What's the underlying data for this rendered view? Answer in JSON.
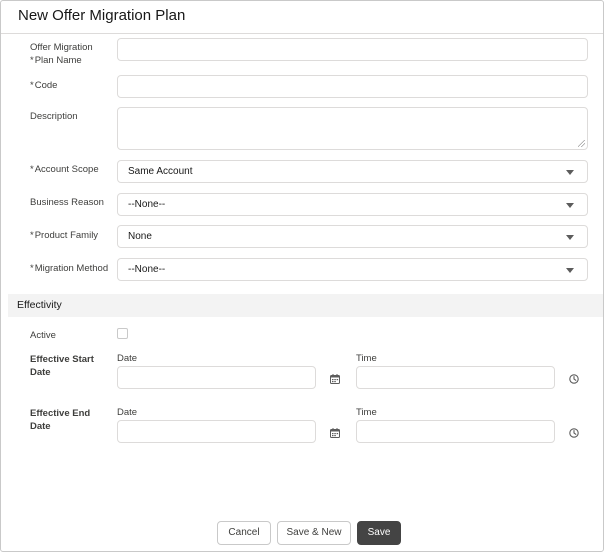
{
  "header": {
    "title": "New Offer Migration Plan"
  },
  "fields": {
    "plan_name": {
      "label_line1": "Offer Migration",
      "label_line2": "Plan Name",
      "required": "*",
      "value": ""
    },
    "code": {
      "label": "Code",
      "required": "*",
      "value": ""
    },
    "description": {
      "label": "Description",
      "value": ""
    },
    "account_scope": {
      "label": "Account Scope",
      "required": "*",
      "value": "Same Account"
    },
    "business_reason": {
      "label": "Business Reason",
      "value": "--None--"
    },
    "product_family": {
      "label": "Product Family",
      "required": "*",
      "value": "None"
    },
    "migration_method": {
      "label": "Migration Method",
      "required": "*",
      "value": "--None--"
    }
  },
  "effectivity": {
    "title": "Effectivity",
    "active_label": "Active",
    "active_checked": false,
    "start": {
      "label_line1": "Effective Start",
      "label_line2": "Date",
      "date_label": "Date",
      "time_label": "Time"
    },
    "end": {
      "label_line1": "Effective End",
      "label_line2": "Date",
      "date_label": "Date",
      "time_label": "Time"
    }
  },
  "footer": {
    "cancel": "Cancel",
    "save_new": "Save & New",
    "save": "Save"
  },
  "icons": {
    "calendar": "calendar-icon",
    "clock": "clock-icon",
    "dropdown": "chevron-down-icon"
  },
  "colors": {
    "primary_button": "#444444",
    "section_bg": "#f3f3f3",
    "border": "#dddbda"
  }
}
